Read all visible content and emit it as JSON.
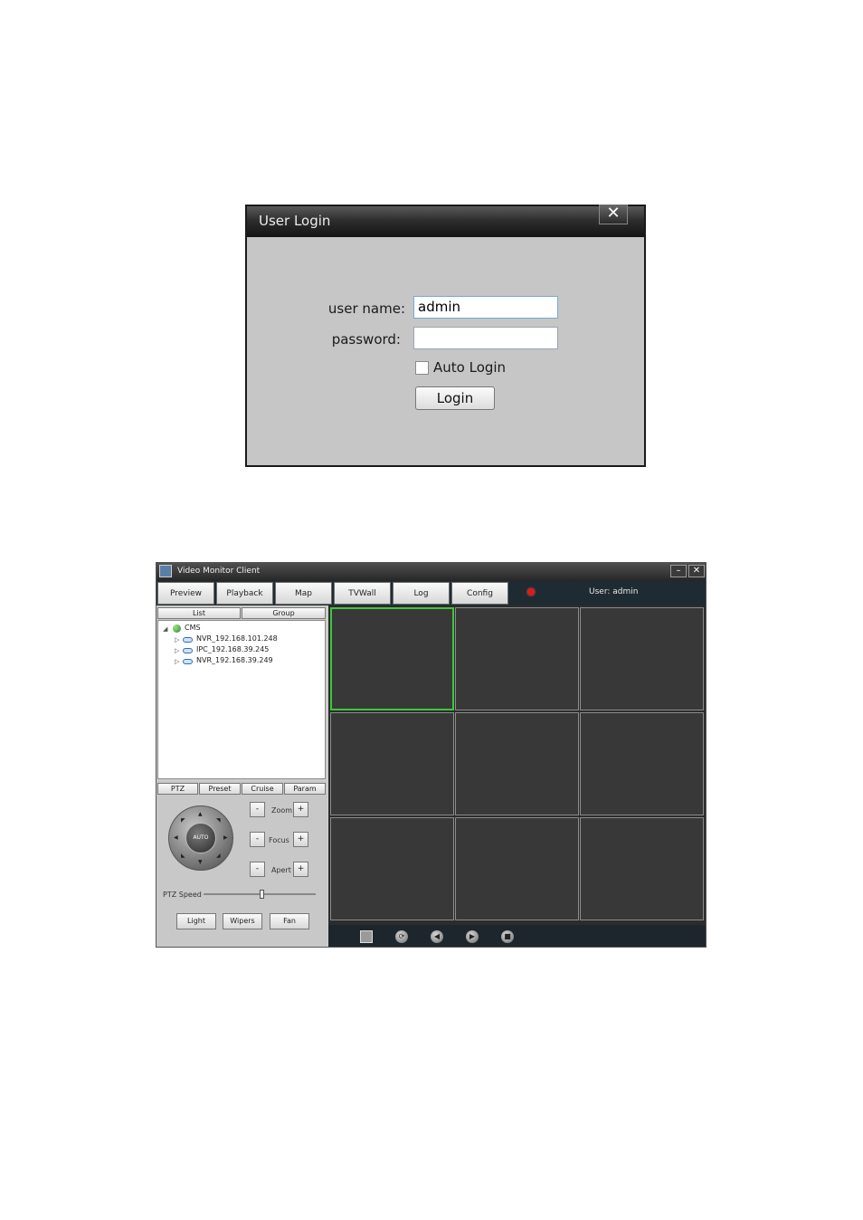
{
  "login_dialog": {
    "title": "User Login",
    "close_glyph": "✕",
    "username_label": "user name:",
    "username_value": "admin",
    "password_label": "password:",
    "password_value": "",
    "auto_login_label": "Auto Login",
    "auto_login_checked": false,
    "login_button": "Login"
  },
  "client": {
    "title": "Video Monitor Client",
    "minimize_glyph": "–",
    "close_glyph": "✕",
    "nav": [
      "Preview",
      "Playback",
      "Map",
      "TVWall",
      "Log",
      "Config"
    ],
    "user_label": "User: admin",
    "panel_tabs": [
      "List",
      "Group"
    ],
    "tree": {
      "root": "CMS",
      "devices": [
        "NVR_192.168.101.248",
        "IPC_192.168.39.245",
        "NVR_192.168.39.249"
      ]
    },
    "ptz_tabs": [
      "PTZ",
      "Preset",
      "Cruise",
      "Param"
    ],
    "joystick_label": "AUTO",
    "controls": [
      {
        "label": "Zoom",
        "minus": "-",
        "plus": "+"
      },
      {
        "label": "Focus",
        "minus": "-",
        "plus": "+"
      },
      {
        "label": "Apert",
        "minus": "-",
        "plus": "+"
      }
    ],
    "ptz_speed_label": "PTZ Speed",
    "ptz_speed_level": 0.52,
    "aux_buttons": [
      "Light",
      "Wipers",
      "Fan"
    ],
    "video_grid": {
      "rows": 3,
      "cols": 3,
      "selected_index": 0
    },
    "video_toolbar_icons": [
      "layout-grid-icon",
      "screen-switch-icon",
      "previous-icon",
      "next-icon",
      "stop-icon"
    ],
    "colors": {
      "selected_cell": "#3cc83c",
      "alarm": "#e01818"
    }
  }
}
